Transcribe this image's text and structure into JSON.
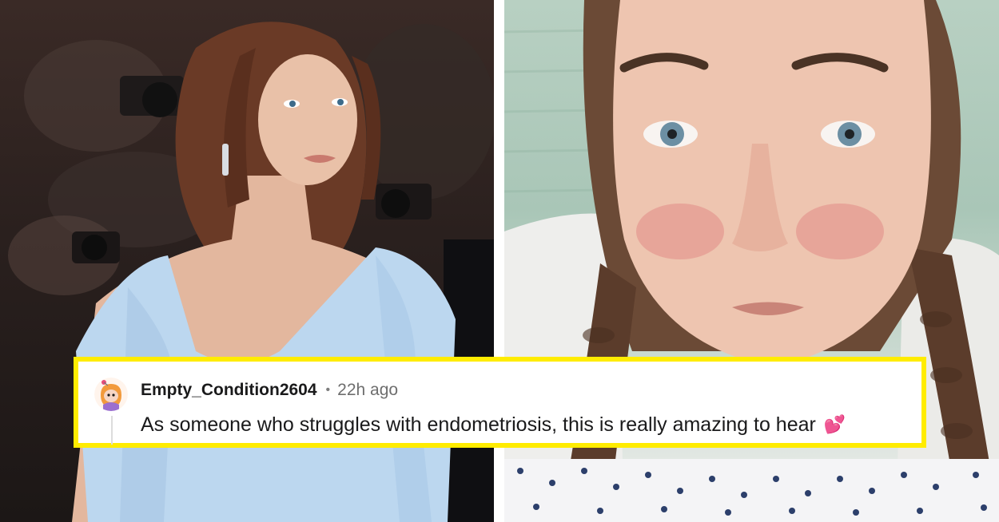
{
  "comment": {
    "username": "Empty_Condition2604",
    "separator": "•",
    "time_ago": "22h ago",
    "text": "As someone who struggles with endometriosis, this is really amazing to hear",
    "emoji": "💕"
  },
  "colors": {
    "highlight_border": "#ffec00",
    "text_primary": "#1a1a1b",
    "text_muted": "#6e6e6e"
  },
  "icons": {
    "avatar": "reddit-snoo-avatar-icon",
    "heart": "two-hearts-icon"
  }
}
